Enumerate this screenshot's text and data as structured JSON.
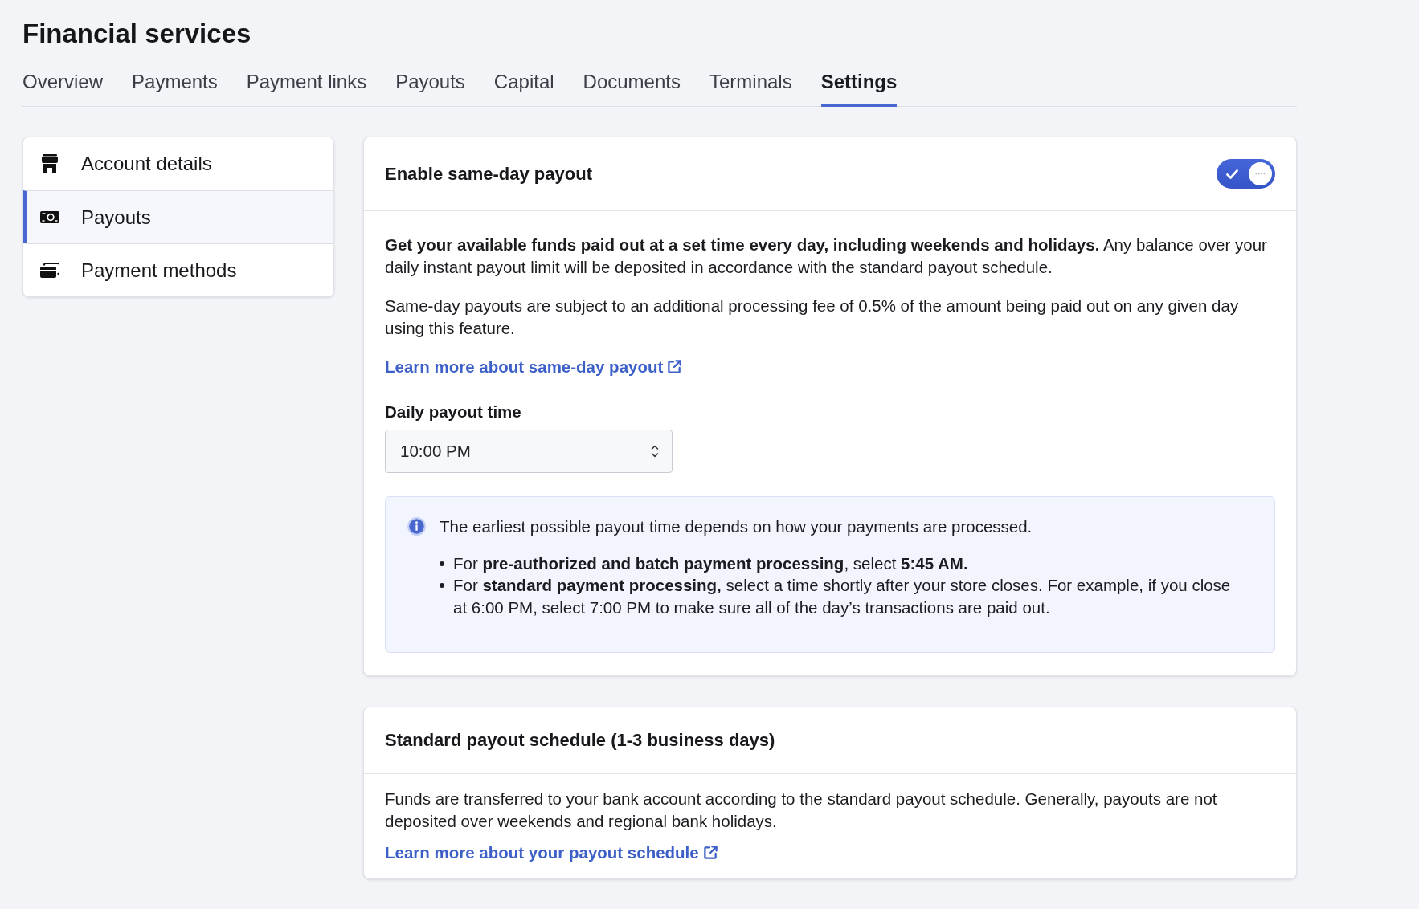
{
  "title": "Financial services",
  "tabs": [
    {
      "label": "Overview",
      "selected": false
    },
    {
      "label": "Payments",
      "selected": false
    },
    {
      "label": "Payment links",
      "selected": false
    },
    {
      "label": "Payouts",
      "selected": false
    },
    {
      "label": "Capital",
      "selected": false
    },
    {
      "label": "Documents",
      "selected": false
    },
    {
      "label": "Terminals",
      "selected": false
    },
    {
      "label": "Settings",
      "selected": true
    }
  ],
  "sidebar": {
    "items": [
      {
        "label": "Account details",
        "selected": false
      },
      {
        "label": "Payouts",
        "selected": true
      },
      {
        "label": "Payment methods",
        "selected": false
      }
    ]
  },
  "sections": [
    {
      "title": "Enable same-day payout",
      "toggle": {
        "on": true
      },
      "paragraphs": [
        "**Get your available funds paid out at a set time every day, including weekends and holidays.** Any balance over your daily instant payout limit will be deposited in accordance with the standard payout schedule.",
        "Same-day payouts are subject to an additional processing fee of 0.5% of the amount being paid out on any given day using this feature."
      ],
      "link": "Learn more about same-day payout",
      "field": {
        "label": "Daily payout time",
        "value": "10:00 PM"
      },
      "notice": {
        "text": "The earliest possible payout time depends on how your payments are processed.",
        "bullets": [
          "For **pre-authorized and batch payment processing**, select **5:45 AM.**",
          "For **standard payment processing,** select a time shortly after your store closes. For example, if you close at 6:00 PM, select 7:00 PM to make sure all of the day’s transactions are paid out."
        ]
      }
    },
    {
      "title": "Standard payout schedule (1-3 business days)",
      "paragraphs": [
        "Funds are transferred to your bank account according to the standard payout schedule. Generally, payouts are not deposited over weekends and regional bank holidays."
      ],
      "link": "Learn more about your payout schedule"
    }
  ]
}
